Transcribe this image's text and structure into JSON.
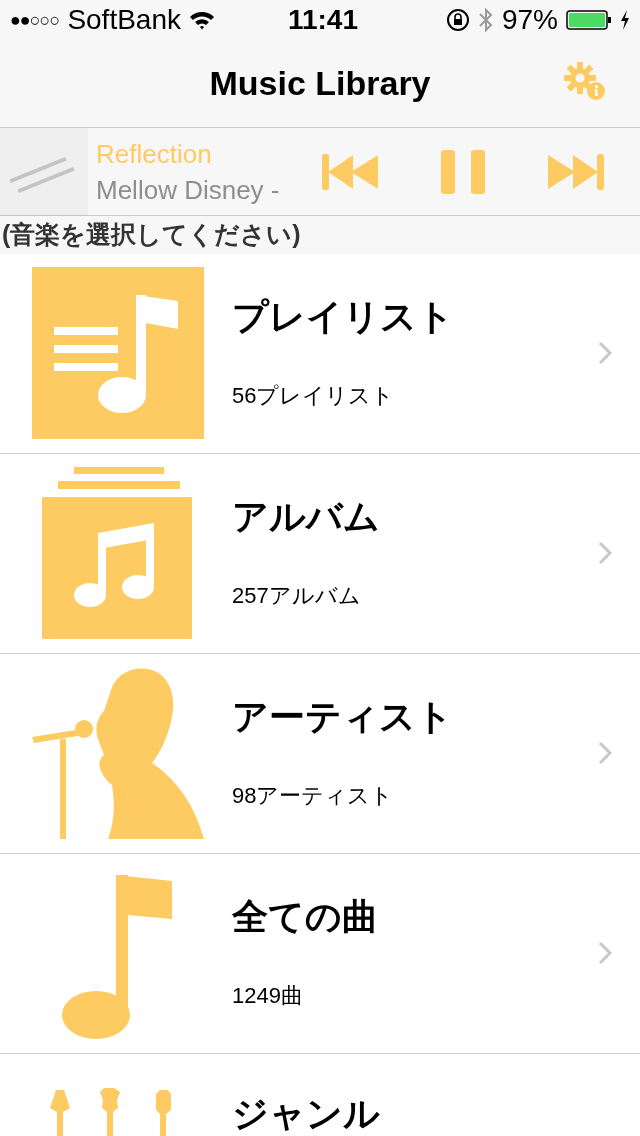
{
  "status_bar": {
    "signal_dots": "●●○○○",
    "carrier": "SoftBank",
    "time": "11:41",
    "battery": "97%"
  },
  "nav": {
    "title": "Music Library"
  },
  "now_playing": {
    "title": "Reflection",
    "artist": "Mellow Disney -",
    "playing": true
  },
  "section_header": "(音楽を選択してください)",
  "categories": [
    {
      "kind": "playlist",
      "title": "プレイリスト",
      "count": "56プレイリスト"
    },
    {
      "kind": "album",
      "title": "アルバム",
      "count": "257アルバム"
    },
    {
      "kind": "artist",
      "title": "アーティスト",
      "count": "98アーティスト"
    },
    {
      "kind": "songs",
      "title": "全ての曲",
      "count": "1249曲"
    },
    {
      "kind": "genre",
      "title": "ジャンル"
    }
  ]
}
